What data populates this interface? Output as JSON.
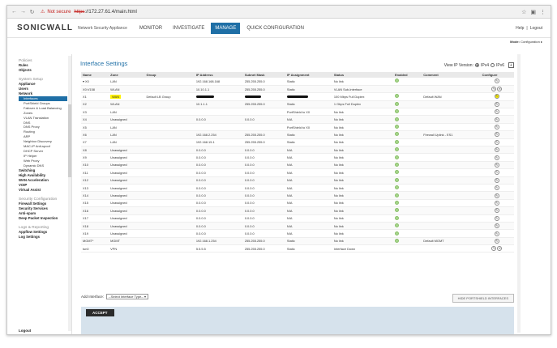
{
  "browser": {
    "security": "Not secure",
    "url_strike": "https",
    "url_rest": "://172.27.61.4/main.html"
  },
  "header": {
    "logo": "SONICWALL",
    "appliance": "Network Security Appliance",
    "nav": [
      "MONITOR",
      "INVESTIGATE",
      "MANAGE",
      "QUICK CONFIGURATION"
    ],
    "active_nav": "MANAGE",
    "help": "Help",
    "separator": "|",
    "logout": "Logout",
    "mode_label": "Mode:",
    "mode_value": "Configuration ▸"
  },
  "sidebar": {
    "groups": [
      {
        "category": "Policies",
        "items": [
          {
            "label": "Rules"
          },
          {
            "label": "Objects"
          }
        ]
      },
      {
        "category": "System Setup",
        "items": [
          {
            "label": "Appliance"
          },
          {
            "label": "Users"
          },
          {
            "label": "Network",
            "subs": [
              "Interfaces",
              "PortShield Groups",
              "Failover & Load Balancing",
              "Zones",
              "VLAN Translation",
              "DNS",
              "DNS Proxy",
              "Routing",
              "ARP",
              "Neighbor Discovery",
              "MAC-IP Anti-spoof",
              "DHCP Server",
              "IP Helper",
              "Web Proxy",
              "Dynamic DNS"
            ]
          },
          {
            "label": "Switching"
          },
          {
            "label": "High Availability"
          },
          {
            "label": "WAN Acceleration"
          },
          {
            "label": "VOIP"
          },
          {
            "label": "Virtual Assist"
          }
        ]
      },
      {
        "category": "Security Configuration",
        "items": [
          {
            "label": "Firewall Settings"
          },
          {
            "label": "Security Services"
          },
          {
            "label": "Anti-spam"
          },
          {
            "label": "Deep Packet Inspection"
          }
        ]
      },
      {
        "category": "Logs & Reporting",
        "items": [
          {
            "label": "Appflow Settings"
          },
          {
            "label": "Log Settings"
          }
        ]
      }
    ],
    "selected": "Interfaces",
    "bottom": "Logout"
  },
  "main": {
    "title": "Interface Settings",
    "ip_version_label": "View IP Version:",
    "ipv4": "IPv4",
    "ipv6": "IPv6",
    "columns": [
      "Name",
      "Zone",
      "Group",
      "IP Address",
      "Subnet Mask",
      "IP Assignment",
      "Status",
      "Enabled",
      "Comment",
      "Configure"
    ],
    "rows": [
      {
        "name": "▾ X0",
        "zone": "LAN",
        "group": "",
        "ip": "192.168.168.168",
        "mask": "255.255.255.0",
        "assign": "Static",
        "status": "No link",
        "enabled": true,
        "comment": "",
        "cfg": 1
      },
      {
        "name": "X0:V158",
        "zone": "WLAN",
        "group": "",
        "ip": "10.10.1.1",
        "mask": "255.255.255.0",
        "assign": "Static",
        "status": "VLAN Sub-Interface",
        "enabled": false,
        "comment": "",
        "cfg": 2
      },
      {
        "name": "X1",
        "zone": "WAN",
        "group": "Default LB Group",
        "ip": "",
        "mask": "",
        "assign": "",
        "status": "100 Mbps Full Duplex",
        "enabled": true,
        "comment": "Default WAN",
        "cfg": 1,
        "highlight": true,
        "redacted": true
      },
      {
        "name": "X2",
        "zone": "WLAN",
        "group": "",
        "ip": "10.1.1.1",
        "mask": "255.255.255.0",
        "assign": "Static",
        "status": "1 Gbps Full Duplex",
        "enabled": true,
        "comment": "",
        "cfg": 1
      },
      {
        "name": "X3",
        "zone": "LAN",
        "group": "",
        "ip": "",
        "mask": "",
        "assign": "PortShield to X0",
        "status": "No link",
        "enabled": true,
        "comment": "",
        "cfg": 1
      },
      {
        "name": "X4",
        "zone": "Unassigned",
        "group": "",
        "ip": "0.0.0.0",
        "mask": "0.0.0.0",
        "assign": "N/A",
        "status": "No link",
        "enabled": true,
        "comment": "",
        "cfg": 1
      },
      {
        "name": "X5",
        "zone": "LAN",
        "group": "",
        "ip": "",
        "mask": "",
        "assign": "PortShield to X0",
        "status": "No link",
        "enabled": true,
        "comment": "",
        "cfg": 1
      },
      {
        "name": "X6",
        "zone": "LAN",
        "group": "",
        "ip": "192.168.2.254",
        "mask": "255.255.255.0",
        "assign": "Static",
        "status": "No link",
        "enabled": true,
        "comment": "Firewall Uplink - ES1",
        "cfg": 1
      },
      {
        "name": "X7",
        "zone": "LAN",
        "group": "",
        "ip": "192.168.15.1",
        "mask": "255.255.255.0",
        "assign": "Static",
        "status": "No link",
        "enabled": true,
        "comment": "",
        "cfg": 1
      },
      {
        "name": "X8",
        "zone": "Unassigned",
        "group": "",
        "ip": "0.0.0.0",
        "mask": "0.0.0.0",
        "assign": "N/A",
        "status": "No link",
        "enabled": true,
        "comment": "",
        "cfg": 1
      },
      {
        "name": "X9",
        "zone": "Unassigned",
        "group": "",
        "ip": "0.0.0.0",
        "mask": "0.0.0.0",
        "assign": "N/A",
        "status": "No link",
        "enabled": true,
        "comment": "",
        "cfg": 1
      },
      {
        "name": "X10",
        "zone": "Unassigned",
        "group": "",
        "ip": "0.0.0.0",
        "mask": "0.0.0.0",
        "assign": "N/A",
        "status": "No link",
        "enabled": true,
        "comment": "",
        "cfg": 1
      },
      {
        "name": "X11",
        "zone": "Unassigned",
        "group": "",
        "ip": "0.0.0.0",
        "mask": "0.0.0.0",
        "assign": "N/A",
        "status": "No link",
        "enabled": true,
        "comment": "",
        "cfg": 1
      },
      {
        "name": "X12",
        "zone": "Unassigned",
        "group": "",
        "ip": "0.0.0.0",
        "mask": "0.0.0.0",
        "assign": "N/A",
        "status": "No link",
        "enabled": true,
        "comment": "",
        "cfg": 1
      },
      {
        "name": "X13",
        "zone": "Unassigned",
        "group": "",
        "ip": "0.0.0.0",
        "mask": "0.0.0.0",
        "assign": "N/A",
        "status": "No link",
        "enabled": true,
        "comment": "",
        "cfg": 1
      },
      {
        "name": "X14",
        "zone": "Unassigned",
        "group": "",
        "ip": "0.0.0.0",
        "mask": "0.0.0.0",
        "assign": "N/A",
        "status": "No link",
        "enabled": true,
        "comment": "",
        "cfg": 1
      },
      {
        "name": "X15",
        "zone": "Unassigned",
        "group": "",
        "ip": "0.0.0.0",
        "mask": "0.0.0.0",
        "assign": "N/A",
        "status": "No link",
        "enabled": true,
        "comment": "",
        "cfg": 1
      },
      {
        "name": "X16",
        "zone": "Unassigned",
        "group": "",
        "ip": "0.0.0.0",
        "mask": "0.0.0.0",
        "assign": "N/A",
        "status": "No link",
        "enabled": true,
        "comment": "",
        "cfg": 1
      },
      {
        "name": "X17",
        "zone": "Unassigned",
        "group": "",
        "ip": "0.0.0.0",
        "mask": "0.0.0.0",
        "assign": "N/A",
        "status": "No link",
        "enabled": true,
        "comment": "",
        "cfg": 1
      },
      {
        "name": "X18",
        "zone": "Unassigned",
        "group": "",
        "ip": "0.0.0.0",
        "mask": "0.0.0.0",
        "assign": "N/A",
        "status": "No link",
        "enabled": true,
        "comment": "",
        "cfg": 1
      },
      {
        "name": "X19",
        "zone": "Unassigned",
        "group": "",
        "ip": "0.0.0.0",
        "mask": "0.0.0.0",
        "assign": "N/A",
        "status": "No link",
        "enabled": true,
        "comment": "",
        "cfg": 1
      },
      {
        "name": "MGMT*",
        "zone": "MGMT",
        "group": "",
        "ip": "192.168.1.254",
        "mask": "255.255.255.0",
        "assign": "Static",
        "status": "No link",
        "enabled": true,
        "comment": "Default MGMT",
        "cfg": 1
      },
      {
        "name": "tun0",
        "zone": "VPN",
        "group": "",
        "ip": "5.5.5.5",
        "mask": "255.255.255.0",
        "assign": "Static",
        "status": "Interface Down",
        "enabled": false,
        "comment": "",
        "cfg": 2
      }
    ],
    "add_interface_label": "Add Interface:",
    "add_interface_select": "--Select Interface Type--",
    "hide_portshield": "HIDE PORTSHIELD INTERFACES",
    "accept": "ACCEPT"
  },
  "colors": {
    "accent": "#1f6fa6",
    "highlight": "#fff200",
    "enabled_dot": "#a8d68d"
  },
  "icons": [
    "back-icon",
    "forward-icon",
    "reload-icon",
    "warning-icon",
    "star-icon",
    "menu-icon",
    "gear-icon",
    "delete-icon"
  ]
}
